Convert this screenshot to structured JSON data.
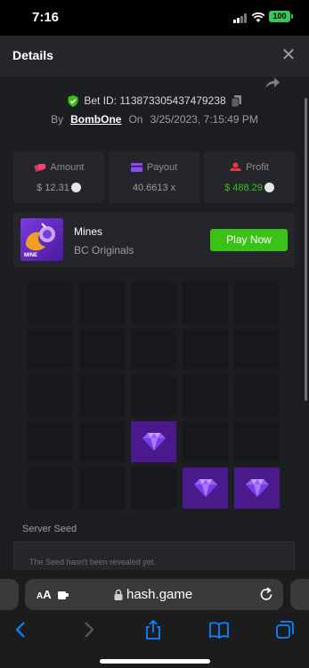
{
  "status_bar": {
    "time": "7:16",
    "battery": "100"
  },
  "modal": {
    "title": "Details"
  },
  "bet": {
    "id_text": "Bet ID: 113873305437479238",
    "by_label": "By",
    "username": "BombOne",
    "on_label": "On",
    "datetime": "3/25/2023, 7:15:49 PM"
  },
  "stats": {
    "amount": {
      "label": "Amount",
      "value": "$ 12.31"
    },
    "payout": {
      "label": "Payout",
      "value": "40.6613 x"
    },
    "profit": {
      "label": "Profit",
      "value": "$ 488.29"
    }
  },
  "game": {
    "name": "Mines",
    "provider": "BC Originals",
    "thumb_text": "MINE",
    "play_label": "Play Now"
  },
  "mines_grid": {
    "rows": 5,
    "cols": 5,
    "gems": [
      [
        3,
        2
      ],
      [
        4,
        3
      ],
      [
        4,
        4
      ]
    ]
  },
  "seed": {
    "label": "Server Seed",
    "text": "The Seed hasn't been revealed yet."
  },
  "safari": {
    "aa": "AA",
    "url": "hash.game"
  },
  "colors": {
    "accent_green": "#3bc117",
    "gem_bg": "#4a1a8c",
    "panel": "#25262b"
  }
}
